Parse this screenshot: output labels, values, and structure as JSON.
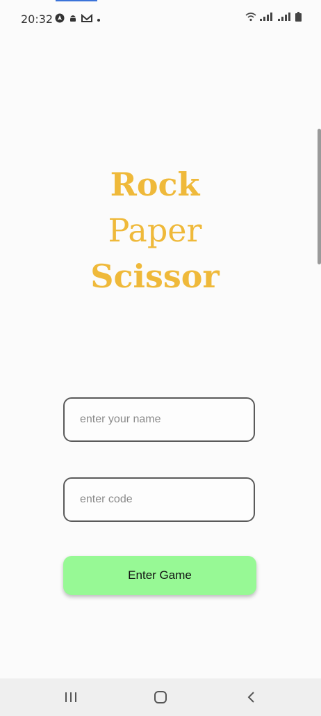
{
  "status_bar": {
    "time": "20:32",
    "left_icons": [
      "navigation-icon",
      "android-icon",
      "mail-icon",
      "dot-icon"
    ],
    "right_icons": [
      "wifi-icon",
      "signal-icon-1",
      "signal-icon-2",
      "battery-icon"
    ]
  },
  "title": {
    "line1": "Rock",
    "line2": "Paper",
    "line3": "Scissor",
    "color": "#efb93a"
  },
  "form": {
    "name_placeholder": "enter your name",
    "code_placeholder": "enter code",
    "enter_button_label": "Enter Game",
    "button_color": "#97f995"
  },
  "nav": {
    "recents_icon": "recents-icon",
    "home_icon": "home-icon",
    "back_icon": "back-icon"
  }
}
